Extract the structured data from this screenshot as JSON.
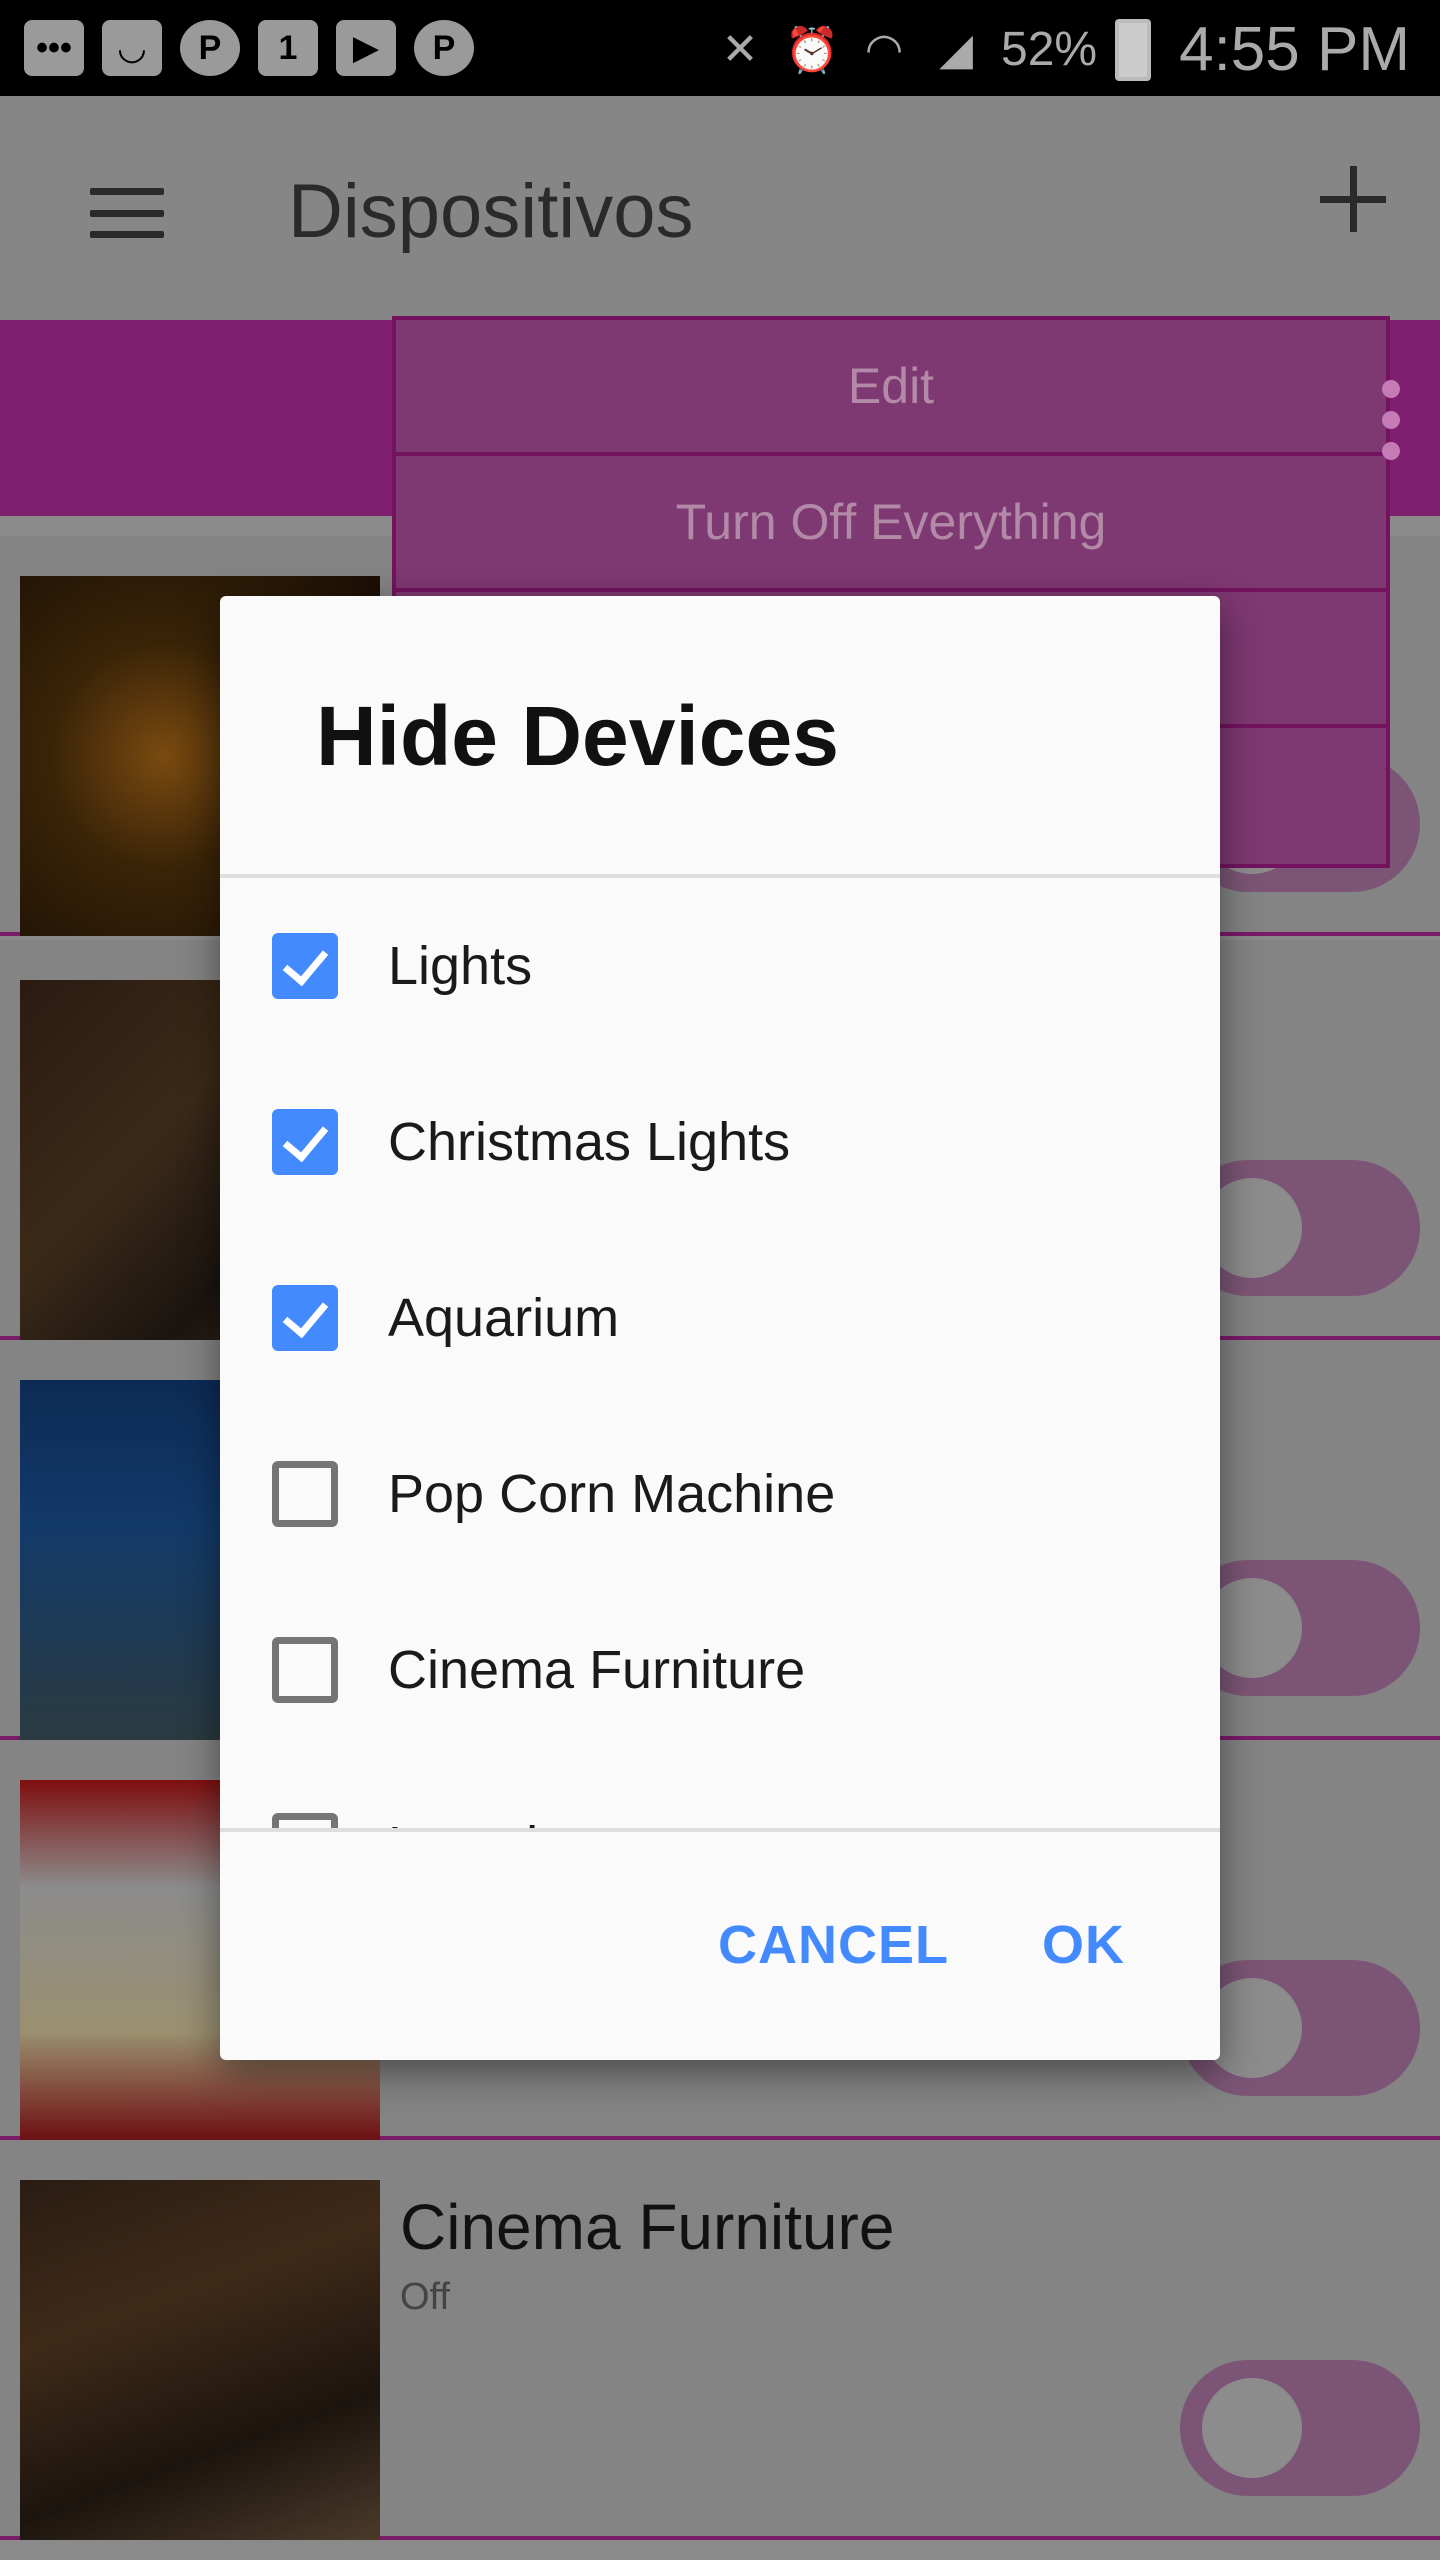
{
  "status_bar": {
    "battery": "52%",
    "time": "4:55 PM",
    "left_icons": [
      "messages-icon",
      "inbox-icon",
      "pinterest-icon",
      "calendar-icon",
      "youtube-icon",
      "pinterest-icon"
    ],
    "right_icons": [
      "mute-icon",
      "alarm-icon",
      "wifi-icon",
      "signal-icon"
    ]
  },
  "app_bar": {
    "title": "Dispositivos",
    "menu_icon": "hamburger-icon",
    "add_icon": "plus-icon"
  },
  "overflow_menu": {
    "items": [
      "Edit",
      "Turn Off Everything",
      "",
      ""
    ]
  },
  "devices": [
    {
      "name": "",
      "status": "",
      "thumb": "lights"
    },
    {
      "name": "",
      "status": "",
      "thumb": "christmas"
    },
    {
      "name": "",
      "status": "",
      "thumb": "aquarium"
    },
    {
      "name": "",
      "status": "",
      "thumb": "popcorn"
    },
    {
      "name": "Cinema Furniture",
      "status": "Off",
      "thumb": "cinema"
    }
  ],
  "dialog": {
    "title": "Hide Devices",
    "items": [
      {
        "label": "Lights",
        "checked": true
      },
      {
        "label": "Christmas Lights",
        "checked": true
      },
      {
        "label": "Aquarium",
        "checked": true
      },
      {
        "label": "Pop Corn Machine",
        "checked": false
      },
      {
        "label": "Cinema Furniture",
        "checked": false
      },
      {
        "label": "Laundry",
        "checked": false
      }
    ],
    "cancel_label": "CANCEL",
    "ok_label": "OK"
  },
  "colors": {
    "accent": "#448aff",
    "primary": "#9c27b0",
    "scrim_primary": "#7e1f6f"
  }
}
